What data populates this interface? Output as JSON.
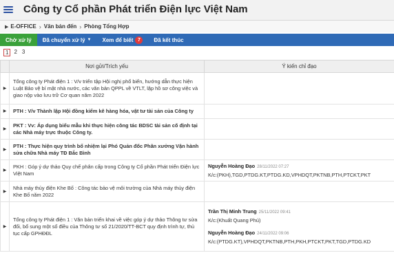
{
  "header": {
    "title": "Công ty Cổ phần Phát triển Điện lực Việt Nam"
  },
  "breadcrumb": [
    "E-OFFICE",
    "Văn bản đến",
    "Phòng Tổng Hợp"
  ],
  "tabs": [
    {
      "label": "Chờ xử lý"
    },
    {
      "label": "Đã chuyển xử lý"
    },
    {
      "label": "Xem để biết",
      "badge": "7"
    },
    {
      "label": "Đã kết thúc"
    }
  ],
  "pager": [
    "1",
    "2",
    "3"
  ],
  "table": {
    "columns": [
      "Nơi gửi/Trích yếu",
      "Ý kiến chỉ đạo"
    ],
    "rows": [
      {
        "subject": "Tổng công ty Phát điện 1 : V/v triển tập Hội nghị phổ biến, hướng dẫn thực hiện Luật Bảo vệ bí mật nhà nước, các văn bản QPPL về VTLT, lập hồ sơ công việc và giao nộp vào lưu trữ Cơ quan năm 2022",
        "bold": false,
        "opinions": []
      },
      {
        "subject": "PTH : V/v Thành lập Hội đồng kiểm kê hàng hóa, vật tư tài sản của Công ty",
        "bold": true,
        "opinions": []
      },
      {
        "subject": "PKT : Vv: Áp dụng biểu mẫu khi thực hiện công tác BDSC tài sản cố định tại các Nhà máy trực thuộc Công ty.",
        "bold": true,
        "opinions": []
      },
      {
        "subject": "PTH : Thực hiện quy trình bổ nhiệm lại Phó Quản đốc Phân xưởng Vận hành sửa chữa Nhà máy TĐ Bắc Bình",
        "bold": true,
        "opinions": []
      },
      {
        "subject": "PKH : Góp ý dự thảo Quy chế phân cấp trong Công ty Cổ phần Phát triển Điện lực Việt Nam",
        "bold": false,
        "opinions": [
          {
            "name": "Nguyễn Hoàng Đạo",
            "time": "28/11/2022 07:27",
            "dest": "K/c:(PKH),TGD,PTDG.KT,PTDG.KD,VPHDQT,PKTNB,PTH,PTCKT,PKT"
          }
        ]
      },
      {
        "subject": "Nhà máy thủy điện Khe Bố : Công tác bảo vệ môi trường của Nhà máy thủy điện Khe Bố năm 2022",
        "bold": false,
        "opinions": []
      },
      {
        "subject": "Tổng công ty Phát điện 1 : Văn bản triển khai về việc góp ý dự thảo Thông tư sửa đổi, bổ sung một số điều của Thông tư số 21/2020/TT-BCT quy định trình tự, thủ tục cấp GPHĐĐL",
        "bold": false,
        "opinions": [
          {
            "name": "Trần Thị Minh Trung",
            "time": "25/11/2022 09:41",
            "dest": "K/c:(Khuất Quang Phú)"
          },
          {
            "name": "Nguyễn Hoàng Đạo",
            "time": "24/11/2022 09:06",
            "dest": "K/c:(PTDG.KT),VPHDQT,PKTNB,PTH,PKH,PTCKT,PKT,TGD,PTDG.KD"
          }
        ]
      }
    ]
  }
}
